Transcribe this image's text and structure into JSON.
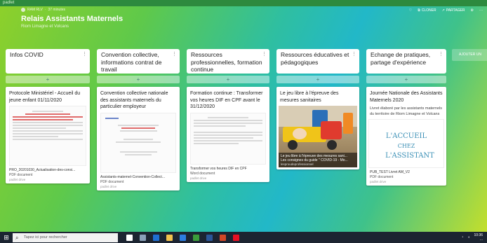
{
  "window": {
    "title": "padlet"
  },
  "header": {
    "author": "RAM RLV",
    "age": "37 minutes",
    "title": "Relais Assistants Maternels",
    "subtitle": "Riom Limagne et Volcans",
    "actions": {
      "like": "♡",
      "clone": "CLONER",
      "share": "PARTAGER",
      "settings": "⚙",
      "more": "···"
    }
  },
  "add_column_label": "AJOUTER UN",
  "columns": [
    {
      "title": "Infos COVID",
      "add": "+",
      "card": {
        "title": "Protocole Ministériel - Accueil du jeune enfant 01/11/2020",
        "file_name": "PRO_20201030_Actualisation-des-consi...",
        "file_type": "PDF document",
        "source": "padlet drive"
      }
    },
    {
      "title": "Convention collective, informations contrat de travail",
      "add": "+",
      "card": {
        "title": "Convention collective nationale des assistants maternels du particulier employeur",
        "file_name": "Assistants-maternel-Convention-Collect...",
        "file_type": "PDF document",
        "source": "padlet drive"
      }
    },
    {
      "title": "Ressources professionnelles, formation continue",
      "add": "+",
      "card": {
        "title": "Formation continue : Transformer vos heures DIF en CPF avant le 31/12/2020",
        "file_name": "Transformer vos heures DIF en CPF",
        "file_type": "Word document",
        "source": "padlet drive"
      }
    },
    {
      "title": "Ressources éducatives et pédagogiques",
      "add": "+",
      "card": {
        "title": "Le jeu libre à l'épreuve des mesures sanitaires",
        "caption": "Le jeu libre à l'épreuve des mesures sani...",
        "caption2": "Les consignes du guide \" COVID-19 - Mo...",
        "caption_src": "lesproudeprofessionnel"
      }
    },
    {
      "title": "Echange de pratiques, partage d'expérience",
      "add": "+",
      "card": {
        "title": "Journée Nationale des Assistants Maternels 2020",
        "body": "Livret élaboré par les assistants maternels du territoire de Riom Limagne et Volcans",
        "art_line1": "L'ACCUEIL",
        "art_line2": "CHEZ",
        "art_line3": "L'ASSISTANT",
        "file_name": "PUB_TEST Livret AM_V2",
        "file_type": "PDF document",
        "source": "padlet drive"
      }
    }
  ],
  "taskbar": {
    "search_placeholder": "Tapez ici pour rechercher",
    "time": "10:36",
    "date": "..."
  }
}
